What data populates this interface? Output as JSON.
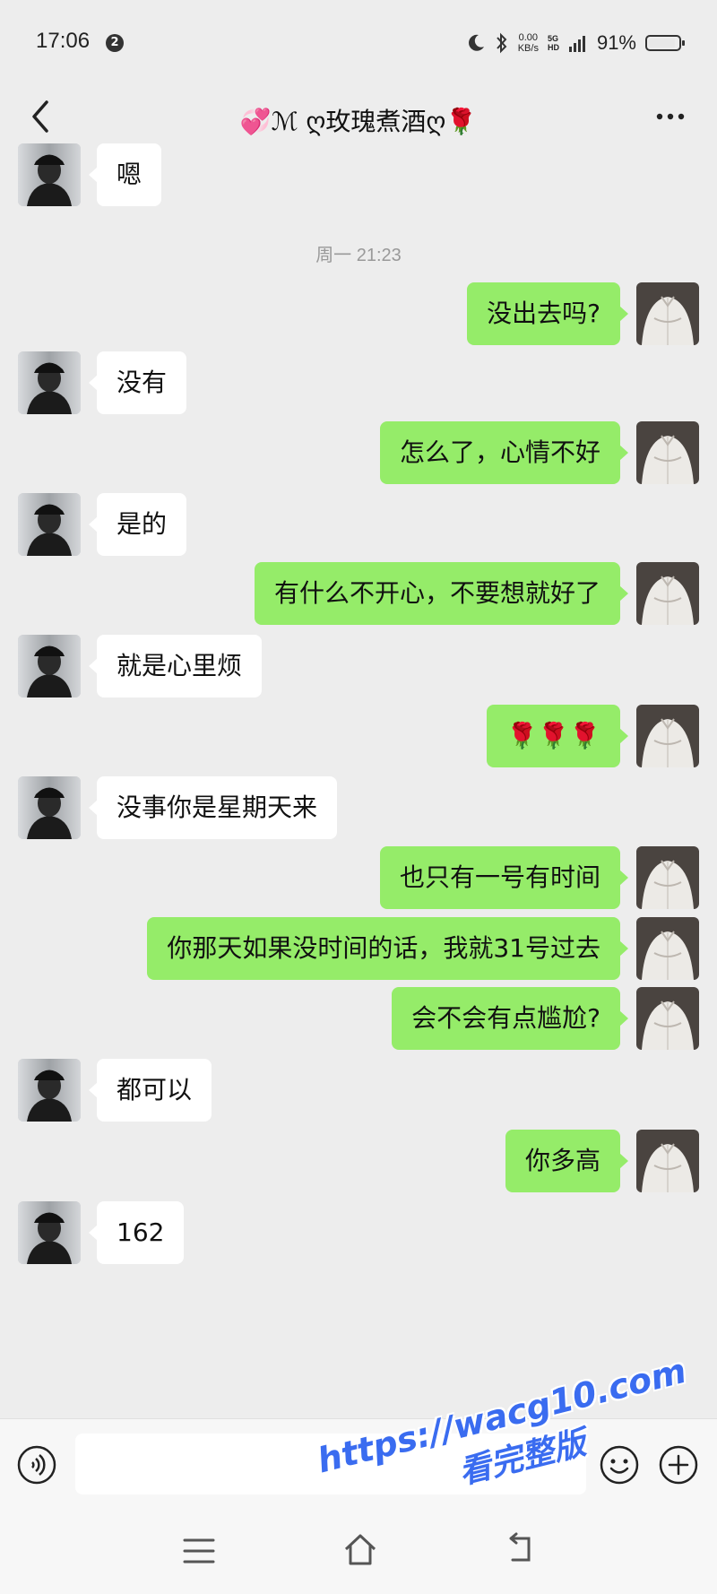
{
  "status_bar": {
    "time": "17:06",
    "notification_badge": "2",
    "net_speed_value": "0.00",
    "net_speed_unit": "KB/s",
    "signal_top": "5G",
    "signal_hd": "HD",
    "battery_percent": "91%",
    "battery_level": 0.91
  },
  "header": {
    "title": "💞ℳ ღ玫瑰煮酒ღ🌹",
    "back_icon": "chevron-left-icon",
    "more_icon": "more-dots-icon"
  },
  "messages": [
    {
      "side": "left",
      "text": "嗯"
    },
    {
      "type": "time",
      "text": "周一 21:23"
    },
    {
      "side": "right",
      "text": "没出去吗?"
    },
    {
      "side": "left",
      "text": "没有"
    },
    {
      "side": "right",
      "text": "怎么了，心情不好"
    },
    {
      "side": "left",
      "text": "是的"
    },
    {
      "side": "right",
      "text": "有什么不开心，不要想就好了"
    },
    {
      "side": "left",
      "text": "就是心里烦"
    },
    {
      "side": "right",
      "text": "🌹🌹🌹"
    },
    {
      "side": "left",
      "text": "没事你是星期天来"
    },
    {
      "side": "right",
      "text": "也只有一号有时间"
    },
    {
      "side": "right",
      "text": "你那天如果没时间的话，我就31号过去"
    },
    {
      "side": "right",
      "text": "会不会有点尴尬?"
    },
    {
      "side": "left",
      "text": "都可以"
    },
    {
      "side": "right",
      "text": "你多高"
    },
    {
      "side": "left",
      "text": "162"
    }
  ],
  "input_bar": {
    "placeholder": "",
    "voice_icon": "voice-icon",
    "emoji_icon": "emoji-icon",
    "plus_icon": "plus-icon"
  },
  "watermark": {
    "url": "https://wacg10.com",
    "subtitle": "看完整版"
  },
  "colors": {
    "background": "#ededed",
    "my_bubble": "#95ec69",
    "their_bubble": "#ffffff",
    "watermark": "#3a6cf0"
  }
}
